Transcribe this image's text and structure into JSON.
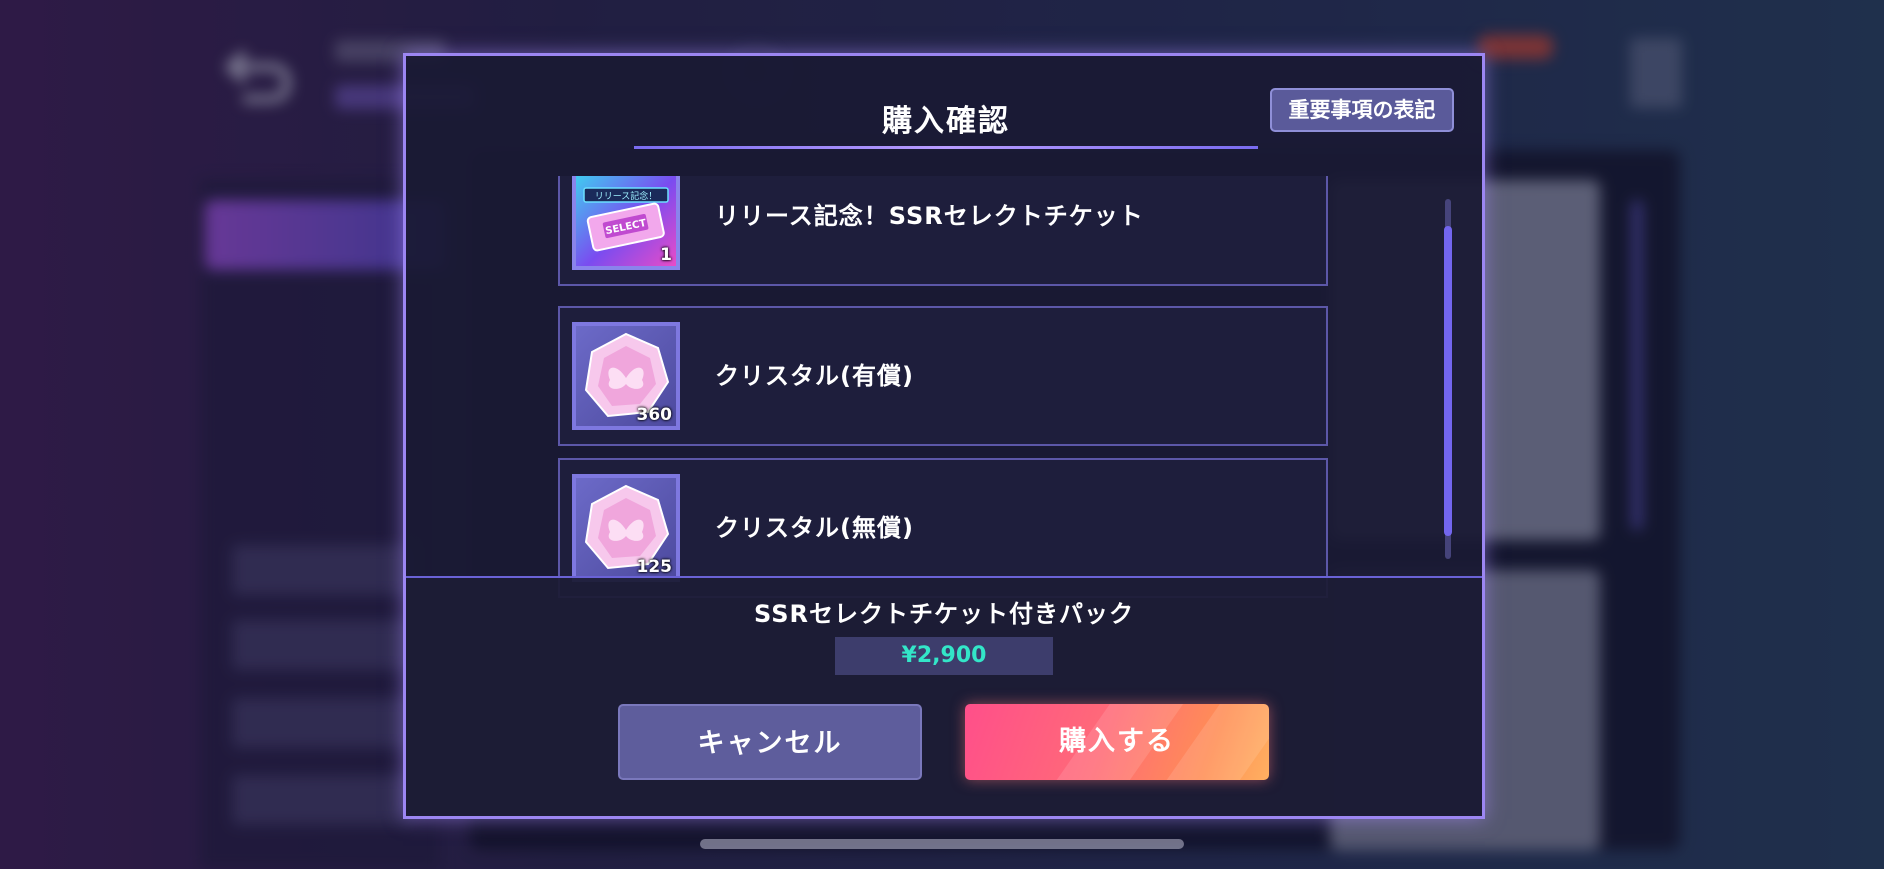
{
  "dialog": {
    "title": "購入確認",
    "notice_button": "重要事項の表記"
  },
  "items": [
    {
      "name": "リリース記念！SSRセレクトチケット",
      "quantity": "1",
      "icon": "select-ticket-icon",
      "ticket_banner": "リリース記念！",
      "ticket_text": "SELECT"
    },
    {
      "name": "クリスタル(有償)",
      "quantity": "360",
      "icon": "crystal-icon"
    },
    {
      "name": "クリスタル(無償)",
      "quantity": "125",
      "icon": "crystal-icon"
    }
  ],
  "pack": {
    "name": "SSRセレクトチケット付きパック",
    "price": "¥2,900"
  },
  "buttons": {
    "cancel": "キャンセル",
    "buy": "購入する"
  },
  "colors": {
    "accent": "#9c86f2",
    "price": "#33e6c8",
    "buy_start": "#ff4f8a",
    "buy_end": "#ffb061"
  }
}
